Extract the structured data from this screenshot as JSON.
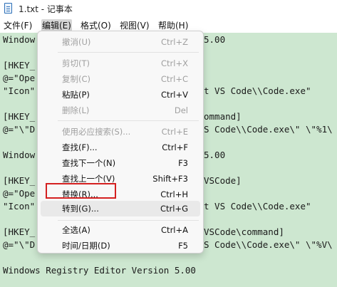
{
  "window": {
    "title": "1.txt - 记事本"
  },
  "menubar": {
    "file": "文件(F)",
    "edit": "编辑(E)",
    "format": "格式(O)",
    "view": "视图(V)",
    "help": "帮助(H)"
  },
  "editor_lines": [
    "Window",
    "",
    "[HKEY_",
    "@=\"Ope",
    "\"Icon\"",
    "",
    "[HKEY_",
    "@=\"\\\"D",
    "",
    "Window",
    "",
    "[HKEY_",
    "@=\"Ope",
    "\"Icon\"",
    "",
    "[HKEY_",
    "@=\"\\\"D",
    "",
    "Windows Registry Editor Version 5.00"
  ],
  "editor_right": [
    "5.00",
    "",
    "",
    "",
    "t VS Code\\\\Code.exe\"",
    "",
    "ommand]",
    "S Code\\\\Code.exe\\\" \\\"%1\\",
    "",
    "5.00",
    "",
    "VSCode]",
    "",
    "t VS Code\\\\Code.exe\"",
    "",
    "VSCode\\command]",
    "S Code\\\\Code.exe\\\" \\\"%V\\"
  ],
  "edit_menu": {
    "items": [
      {
        "label": "撤消(U)",
        "shortcut": "Ctrl+Z",
        "enabled": false
      },
      {
        "label": "剪切(T)",
        "shortcut": "Ctrl+X",
        "enabled": false
      },
      {
        "label": "复制(C)",
        "shortcut": "Ctrl+C",
        "enabled": false
      },
      {
        "label": "粘贴(P)",
        "shortcut": "Ctrl+V",
        "enabled": true
      },
      {
        "label": "删除(L)",
        "shortcut": "Del",
        "enabled": false
      },
      {
        "label": "使用必应搜索(S)...",
        "shortcut": "Ctrl+E",
        "enabled": false
      },
      {
        "label": "查找(F)...",
        "shortcut": "Ctrl+F",
        "enabled": true
      },
      {
        "label": "查找下一个(N)",
        "shortcut": "F3",
        "enabled": true
      },
      {
        "label": "查找上一个(V)",
        "shortcut": "Shift+F3",
        "enabled": true
      },
      {
        "label": "替换(R)...",
        "shortcut": "Ctrl+H",
        "enabled": true
      },
      {
        "label": "转到(G)...",
        "shortcut": "Ctrl+G",
        "enabled": true
      },
      {
        "label": "全选(A)",
        "shortcut": "Ctrl+A",
        "enabled": true
      },
      {
        "label": "时间/日期(D)",
        "shortcut": "F5",
        "enabled": true
      }
    ]
  },
  "colors": {
    "editor_bg": "#cde7d0",
    "highlight_box": "#d42020",
    "disabled_text": "#a0a0a0"
  }
}
